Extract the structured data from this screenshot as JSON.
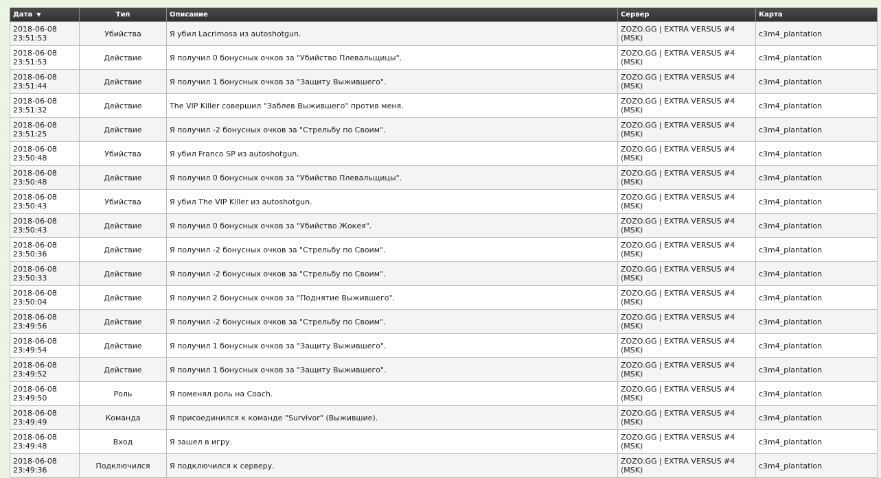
{
  "table": {
    "columns": {
      "date": "Дата",
      "date_sort_arrow": "▼",
      "type": "Тип",
      "description": "Описание",
      "server": "Сервер",
      "map": "Карта"
    },
    "rows": [
      {
        "date": "2018-06-08",
        "time": "23:51:53",
        "type": "Убийства",
        "description": "Я убил Lacrimosa из autoshotgun.",
        "server": "ZOZO.GG | EXTRA VERSUS #4 (MSK)",
        "map": "c3m4_plantation"
      },
      {
        "date": "2018-06-08",
        "time": "23:51:53",
        "type": "Действие",
        "description": "Я получил 0 бонусных очков за \"Убийство Плевальщицы\".",
        "server": "ZOZO.GG | EXTRA VERSUS #4 (MSK)",
        "map": "c3m4_plantation"
      },
      {
        "date": "2018-06-08",
        "time": "23:51:44",
        "type": "Действие",
        "description": "Я получил 1 бонусных очков за \"Защиту Выжившего\".",
        "server": "ZOZO.GG | EXTRA VERSUS #4 (MSK)",
        "map": "c3m4_plantation"
      },
      {
        "date": "2018-06-08",
        "time": "23:51:32",
        "type": "Действие",
        "description": "The VIP Killer совершил \"Заблев Выжившего\" против меня.",
        "server": "ZOZO.GG | EXTRA VERSUS #4 (MSK)",
        "map": "c3m4_plantation"
      },
      {
        "date": "2018-06-08",
        "time": "23:51:25",
        "type": "Действие",
        "description": "Я получил -2 бонусных очков за \"Стрельбу по Своим\".",
        "server": "ZOZO.GG | EXTRA VERSUS #4 (MSK)",
        "map": "c3m4_plantation"
      },
      {
        "date": "2018-06-08",
        "time": "23:50:48",
        "type": "Убийства",
        "description": "Я убил Franco SP из autoshotgun.",
        "server": "ZOZO.GG | EXTRA VERSUS #4 (MSK)",
        "map": "c3m4_plantation"
      },
      {
        "date": "2018-06-08",
        "time": "23:50:48",
        "type": "Действие",
        "description": "Я получил 0 бонусных очков за \"Убийство Плевальщицы\".",
        "server": "ZOZO.GG | EXTRA VERSUS #4 (MSK)",
        "map": "c3m4_plantation"
      },
      {
        "date": "2018-06-08",
        "time": "23:50:43",
        "type": "Убийства",
        "description": "Я убил The VIP Killer из autoshotgun.",
        "server": "ZOZO.GG | EXTRA VERSUS #4 (MSK)",
        "map": "c3m4_plantation"
      },
      {
        "date": "2018-06-08",
        "time": "23:50:43",
        "type": "Действие",
        "description": "Я получил 0 бонусных очков за \"Убийство Жокея\".",
        "server": "ZOZO.GG | EXTRA VERSUS #4 (MSK)",
        "map": "c3m4_plantation"
      },
      {
        "date": "2018-06-08",
        "time": "23:50:36",
        "type": "Действие",
        "description": "Я получил -2 бонусных очков за \"Стрельбу по Своим\".",
        "server": "ZOZO.GG | EXTRA VERSUS #4 (MSK)",
        "map": "c3m4_plantation"
      },
      {
        "date": "2018-06-08",
        "time": "23:50:33",
        "type": "Действие",
        "description": "Я получил -2 бонусных очков за \"Стрельбу по Своим\".",
        "server": "ZOZO.GG | EXTRA VERSUS #4 (MSK)",
        "map": "c3m4_plantation"
      },
      {
        "date": "2018-06-08",
        "time": "23:50:04",
        "type": "Действие",
        "description": "Я получил 2 бонусных очков за \"Поднятие Выжившего\".",
        "server": "ZOZO.GG | EXTRA VERSUS #4 (MSK)",
        "map": "c3m4_plantation"
      },
      {
        "date": "2018-06-08",
        "time": "23:49:56",
        "type": "Действие",
        "description": "Я получил -2 бонусных очков за \"Стрельбу по Своим\".",
        "server": "ZOZO.GG | EXTRA VERSUS #4 (MSK)",
        "map": "c3m4_plantation"
      },
      {
        "date": "2018-06-08",
        "time": "23:49:54",
        "type": "Действие",
        "description": "Я получил 1 бонусных очков за \"Защиту Выжившего\".",
        "server": "ZOZO.GG | EXTRA VERSUS #4 (MSK)",
        "map": "c3m4_plantation"
      },
      {
        "date": "2018-06-08",
        "time": "23:49:52",
        "type": "Действие",
        "description": "Я получил 1 бонусных очков за \"Защиту Выжившего\".",
        "server": "ZOZO.GG | EXTRA VERSUS #4 (MSK)",
        "map": "c3m4_plantation"
      },
      {
        "date": "2018-06-08",
        "time": "23:49:50",
        "type": "Роль",
        "description": "Я поменял роль на Coach.",
        "server": "ZOZO.GG | EXTRA VERSUS #4 (MSK)",
        "map": "c3m4_plantation"
      },
      {
        "date": "2018-06-08",
        "time": "23:49:49",
        "type": "Команда",
        "description": "Я присоединился к команде \"Survivor\" (Выжившие).",
        "server": "ZOZO.GG | EXTRA VERSUS #4 (MSK)",
        "map": "c3m4_plantation"
      },
      {
        "date": "2018-06-08",
        "time": "23:49:48",
        "type": "Вход",
        "description": "Я зашел в игру.",
        "server": "ZOZO.GG | EXTRA VERSUS #4 (MSK)",
        "map": "c3m4_plantation"
      },
      {
        "date": "2018-06-08",
        "time": "23:49:36",
        "type": "Подключился",
        "description": "Я подключился к серверу.",
        "server": "ZOZO.GG | EXTRA VERSUS #4 (MSK)",
        "map": "c3m4_plantation"
      }
    ]
  }
}
